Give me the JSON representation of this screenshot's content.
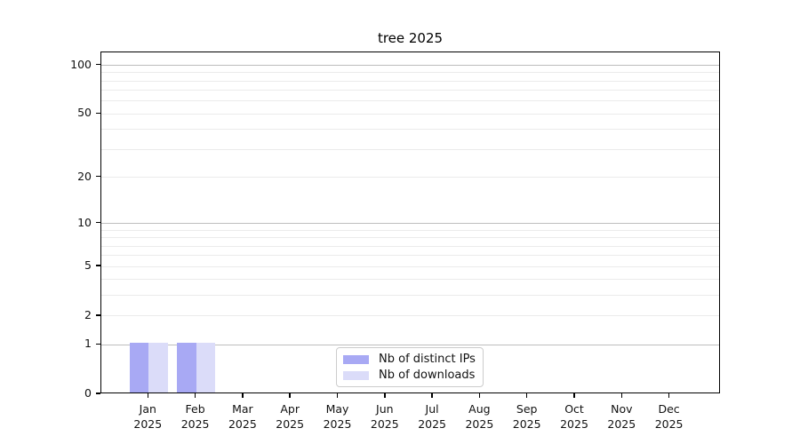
{
  "chart_data": {
    "type": "bar",
    "title": "tree 2025",
    "categories": [
      "Jan",
      "Feb",
      "Mar",
      "Apr",
      "May",
      "Jun",
      "Jul",
      "Aug",
      "Sep",
      "Oct",
      "Nov",
      "Dec"
    ],
    "category_year": "2025",
    "series": [
      {
        "name": "Nb of distinct IPs",
        "color": "#a8a9f4",
        "values": [
          1,
          1,
          0,
          0,
          0,
          0,
          0,
          0,
          0,
          0,
          0,
          0
        ]
      },
      {
        "name": "Nb of downloads",
        "color": "#dbdcf9",
        "values": [
          1,
          1,
          0,
          0,
          0,
          0,
          0,
          0,
          0,
          0,
          0,
          0
        ]
      }
    ],
    "yscale": "log1p",
    "ylim": [
      0,
      120
    ],
    "yticks": [
      0,
      1,
      2,
      5,
      10,
      20,
      50,
      100
    ],
    "major_gridlines": [
      1,
      10,
      100
    ],
    "minor_gridlines": [
      2,
      3,
      4,
      5,
      6,
      7,
      8,
      9,
      20,
      30,
      40,
      50,
      60,
      70,
      80,
      90
    ],
    "grid": true,
    "legend_position": "lower center",
    "colors": {
      "spine": "#000000",
      "major_grid": "#bdbdbd",
      "minor_grid": "#ebebeb",
      "text": "#111111",
      "background": "#ffffff"
    }
  }
}
